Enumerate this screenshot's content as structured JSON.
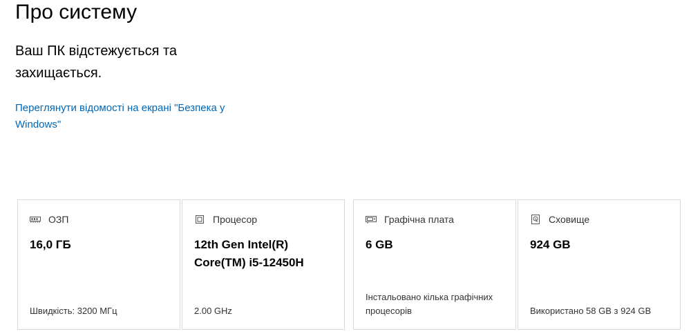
{
  "page": {
    "title": "Про систему"
  },
  "status": {
    "text": "Ваш ПК відстежується та захищається."
  },
  "security_link": {
    "label": "Переглянути відомості на екрані \"Безпека у Windows\""
  },
  "cards": [
    {
      "icon": "memory-icon",
      "label": "ОЗП",
      "value": "16,0 ГБ",
      "footer": "Швидкість: 3200 МГц"
    },
    {
      "icon": "processor-icon",
      "label": "Процесор",
      "value": "12th Gen Intel(R) Core(TM) i5-12450H",
      "footer": "2.00 GHz"
    },
    {
      "icon": "graphics-card-icon",
      "label": "Графічна плата",
      "value": "6 GB",
      "footer": "Інстальовано кілька графічних процесорів"
    },
    {
      "icon": "storage-icon",
      "label": "Сховище",
      "value": "924 GB",
      "footer": "Використано 58 GB з 924 GB"
    }
  ],
  "colors": {
    "link": "#0067b8",
    "card_border": "#d9d9d9",
    "secondary_text": "#333333"
  }
}
